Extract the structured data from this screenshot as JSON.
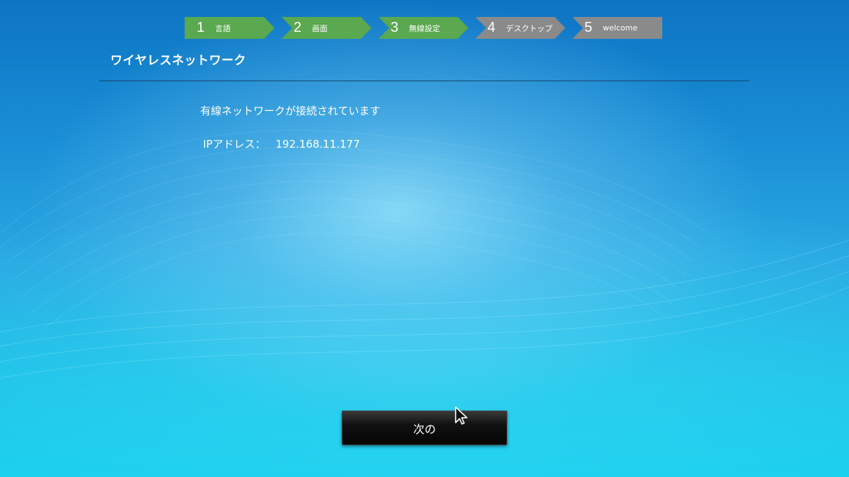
{
  "wizard": {
    "steps": [
      {
        "number": "1",
        "label": "言語",
        "state": "done"
      },
      {
        "number": "2",
        "label": "画面",
        "state": "done"
      },
      {
        "number": "3",
        "label": "無線設定",
        "state": "done"
      },
      {
        "number": "4",
        "label": "デスクトップ",
        "state": "todo"
      },
      {
        "number": "5",
        "label": "welcome",
        "state": "todo"
      }
    ],
    "colors": {
      "done": "#5aa84f",
      "todo": "#8a8a8a"
    }
  },
  "page": {
    "title": "ワイヤレスネットワーク",
    "status": "有線ネットワークが接続されています",
    "ip_label": "IPアドレス：",
    "ip_value": "192.168.11.177"
  },
  "footer": {
    "next_label": "次の"
  },
  "icons": {
    "cursor": "mouse-pointer-icon"
  }
}
